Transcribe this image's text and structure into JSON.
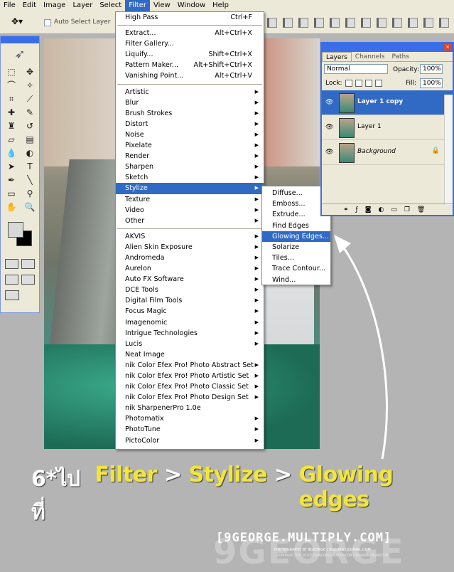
{
  "menubar": {
    "items": [
      "File",
      "Edit",
      "Image",
      "Layer",
      "Select",
      "Filter",
      "View",
      "Window",
      "Help"
    ],
    "active_index": 5
  },
  "options_bar": {
    "auto_select_label": "Auto Select Layer"
  },
  "filter_menu": {
    "top_items": [
      {
        "label": "High Pass",
        "shortcut": "Ctrl+F"
      },
      {
        "label": "Extract...",
        "shortcut": "Alt+Ctrl+X"
      },
      {
        "label": "Filter Gallery...",
        "shortcut": ""
      },
      {
        "label": "Liquify...",
        "shortcut": "Shift+Ctrl+X"
      },
      {
        "label": "Pattern Maker...",
        "shortcut": "Alt+Shift+Ctrl+X"
      },
      {
        "label": "Vanishing Point...",
        "shortcut": "Alt+Ctrl+V"
      }
    ],
    "category_items": [
      "Artistic",
      "Blur",
      "Brush Strokes",
      "Distort",
      "Noise",
      "Pixelate",
      "Render",
      "Sharpen",
      "Sketch",
      "Stylize",
      "Texture",
      "Video",
      "Other"
    ],
    "highlighted_category": "Stylize",
    "plugin_items": [
      "AKVIS",
      "Alien Skin Exposure",
      "Andromeda",
      "Aurelon",
      "Auto FX Software",
      "DCE Tools",
      "Digital Film Tools",
      "Focus Magic",
      "Imagenomic",
      "Intrigue Technologies",
      "Lucis",
      "Neat Image",
      "nik Color Efex Pro! Photo Abstract Set",
      "nik Color Efex Pro! Photo Artistic Set",
      "nik Color Efex Pro! Photo Classic Set",
      "nik Color Efex Pro! Photo Design Set",
      "nik SharpenerPro 1.0e",
      "Photomatix",
      "PhotoTune",
      "PictoColor"
    ],
    "no_arrow_plugins": [
      "Neat Image",
      "nik SharpenerPro 1.0e"
    ]
  },
  "stylize_submenu": {
    "items": [
      "Diffuse...",
      "Emboss...",
      "Extrude...",
      "Find Edges",
      "Glowing Edges...",
      "Solarize",
      "Tiles...",
      "Trace Contour...",
      "Wind..."
    ],
    "highlighted_index": 4
  },
  "layers_panel": {
    "tabs": [
      "Layers",
      "Channels",
      "Paths"
    ],
    "blend_mode": "Normal",
    "opacity_label": "Opacity:",
    "opacity_value": "100%",
    "lock_label": "Lock:",
    "fill_label": "Fill:",
    "fill_value": "100%",
    "layers": [
      {
        "name": "Layer 1 copy",
        "selected": true
      },
      {
        "name": "Layer 1",
        "selected": false
      },
      {
        "name": "Background",
        "selected": false,
        "locked": true
      }
    ]
  },
  "caption": {
    "prefix": "6*ไปที่",
    "step1": "Filter",
    "sep1": ">",
    "step2": "Stylize",
    "sep2": ">",
    "step3": "Glowing edges"
  },
  "watermark": {
    "main": "[9GEORGE.MULTIPLY.COM]",
    "ghost": "9GEORGE",
    "credit": "PHOTOGRAPHY BY 9GEORGE | 9GEORGE@GMAIL.COM",
    "copyright": "COPYRIGHT 2007 BY HTTP://9GEORGE.MULTIPLY.COM | PRAWORN PRASERTSAK"
  },
  "colors": {
    "menu_highlight": "#316ac5",
    "caption_yellow": "#f2e63a",
    "background": "#b4b4b4"
  }
}
